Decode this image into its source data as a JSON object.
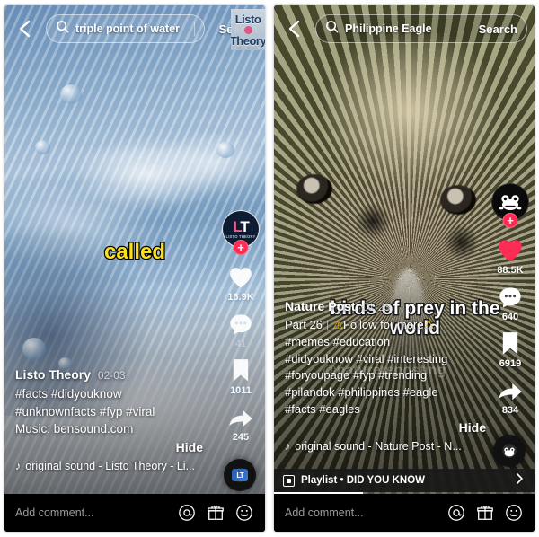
{
  "left": {
    "header": {
      "back_icon": "back-arrow-icon",
      "search_icon": "search-icon",
      "query": "triple point of water",
      "search_button": "Search"
    },
    "watermark": {
      "line1": "Listo",
      "line2": "Theory"
    },
    "caption": "called",
    "rail": {
      "avatar_label": "LT",
      "avatar_sub": "LISTO THEORY",
      "follow_plus": "+",
      "like_icon": "heart-icon",
      "like_count": "16.9K",
      "comment_icon": "comment-icon",
      "comment_count": "41",
      "bookmark_icon": "bookmark-icon",
      "bookmark_count": "1011",
      "share_icon": "share-arrow-icon",
      "share_count": "245"
    },
    "info": {
      "author": "Listo Theory",
      "date": "02-03",
      "desc_line1": "#facts #didyouknow",
      "desc_line2": "#unknownfacts #fyp #viral",
      "desc_line3": "Music: bensound.com",
      "hide": "Hide",
      "music_icon": "music-note-icon",
      "sound": "original sound - Listo Theory - Li..."
    },
    "comment_bar": {
      "placeholder": "Add comment...",
      "mention_icon": "at-mention-icon",
      "gift_icon": "gift-icon",
      "emoji_icon": "emoji-smiley-icon"
    }
  },
  "right": {
    "header": {
      "back_icon": "back-arrow-icon",
      "search_icon": "search-icon",
      "query": "Philippine Eagle",
      "search_button": "Search"
    },
    "caption_line1": "birds of prey in the",
    "caption_line2": "world",
    "user_watermark": "@naturereposting",
    "rail": {
      "avatar_label": "frog-avatar-icon",
      "follow_plus": "+",
      "like_icon": "heart-icon",
      "like_count": "88.5K",
      "comment_icon": "comment-icon",
      "comment_count": "640",
      "bookmark_icon": "bookmark-icon",
      "bookmark_count": "6919",
      "share_icon": "share-arrow-icon",
      "share_count": "834"
    },
    "info": {
      "author": "Nature Post",
      "date": "01-23",
      "part": "Part 26",
      "follow_text": "Follow for more",
      "warn_icon": "warning-triangle-icon",
      "desc_line1": "#memes #education",
      "desc_line2": "#didyouknow #viral #interesting",
      "desc_line3": "#foryoupage #fyp #trending",
      "desc_line4": "#pilandok  #philippines #eagle",
      "desc_line5": "#facts #eagles",
      "hide": "Hide",
      "music_icon": "music-note-icon",
      "sound": "original sound - Nature Post - N..."
    },
    "playlist": {
      "icon": "playlist-icon",
      "label": "Playlist • DID YOU KNOW",
      "chevron": "chevron-right-icon"
    },
    "progress_percent": 34,
    "comment_bar": {
      "placeholder": "Add comment...",
      "mention_icon": "at-mention-icon",
      "gift_icon": "gift-icon",
      "emoji_icon": "emoji-smiley-icon"
    }
  },
  "colors": {
    "accent_red": "#fe2c55",
    "caption_yellow": "#ffe017",
    "warn_yellow": "#ffcc00",
    "bar_black": "#000000"
  }
}
